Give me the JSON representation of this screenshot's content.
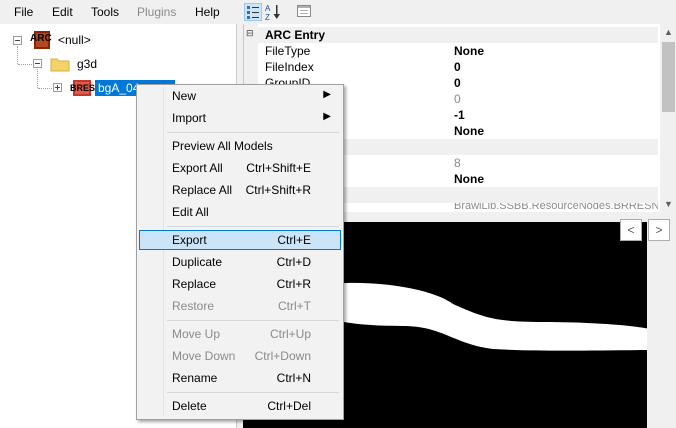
{
  "menubar": {
    "items": [
      {
        "label": "File"
      },
      {
        "label": "Edit"
      },
      {
        "label": "Tools"
      },
      {
        "label": "Plugins"
      },
      {
        "label": "Help"
      }
    ]
  },
  "toolbar": {
    "buttons": [
      {
        "icon": "categorized-view-icon",
        "checked": true
      },
      {
        "icon": "sort-az-icon",
        "checked": false
      },
      {
        "icon": "property-pages-icon",
        "checked": false
      }
    ]
  },
  "tree": {
    "root": {
      "badge": "ARC",
      "label": "<null>"
    },
    "folder": {
      "label": "g3d"
    },
    "item": {
      "badge": "BRES",
      "label": "bgA_04"
    }
  },
  "properties": {
    "category": "ARC Entry",
    "rows": [
      {
        "name": "FileType",
        "value": "None",
        "grey": false
      },
      {
        "name": "FileIndex",
        "value": "0",
        "grey": false
      },
      {
        "name": "GroupID",
        "value": "0",
        "grey": false
      },
      {
        "name": "",
        "value": "0",
        "grey": true
      },
      {
        "name": "",
        "value": "-1",
        "grey": false
      },
      {
        "name": "",
        "value": "None",
        "grey": false
      },
      {
        "name": "",
        "value": "",
        "grey": false
      },
      {
        "name": "",
        "value": "8",
        "grey": true
      },
      {
        "name": "",
        "value": "None",
        "grey": false
      },
      {
        "name": "",
        "value": "",
        "grey": false
      },
      {
        "name": "",
        "value": "BrawlLib.SSBB.ResourceNodes.BRRESN...",
        "grey": true
      }
    ]
  },
  "preview": {
    "prev_label": "<",
    "next_label": ">"
  },
  "context_menu": {
    "items": [
      {
        "label": "New",
        "shortcut": "",
        "submenu": true,
        "disabled": false,
        "highlighted": false
      },
      {
        "label": "Import",
        "shortcut": "",
        "submenu": true,
        "disabled": false,
        "highlighted": false
      },
      {
        "label": "Preview All Models",
        "shortcut": "",
        "submenu": false,
        "disabled": false,
        "highlighted": false
      },
      {
        "label": "Export All",
        "shortcut": "Ctrl+Shift+E",
        "submenu": false,
        "disabled": false,
        "highlighted": false
      },
      {
        "label": "Replace All",
        "shortcut": "Ctrl+Shift+R",
        "submenu": false,
        "disabled": false,
        "highlighted": false
      },
      {
        "label": "Edit All",
        "shortcut": "",
        "submenu": false,
        "disabled": false,
        "highlighted": false
      },
      {
        "label": "Export",
        "shortcut": "Ctrl+E",
        "submenu": false,
        "disabled": false,
        "highlighted": true
      },
      {
        "label": "Duplicate",
        "shortcut": "Ctrl+D",
        "submenu": false,
        "disabled": false,
        "highlighted": false
      },
      {
        "label": "Replace",
        "shortcut": "Ctrl+R",
        "submenu": false,
        "disabled": false,
        "highlighted": false
      },
      {
        "label": "Restore",
        "shortcut": "Ctrl+T",
        "submenu": false,
        "disabled": true,
        "highlighted": false
      },
      {
        "label": "Move Up",
        "shortcut": "Ctrl+Up",
        "submenu": false,
        "disabled": true,
        "highlighted": false
      },
      {
        "label": "Move Down",
        "shortcut": "Ctrl+Down",
        "submenu": false,
        "disabled": true,
        "highlighted": false
      },
      {
        "label": "Rename",
        "shortcut": "Ctrl+N",
        "submenu": false,
        "disabled": false,
        "highlighted": false
      },
      {
        "label": "Delete",
        "shortcut": "Ctrl+Del",
        "submenu": false,
        "disabled": false,
        "highlighted": false
      }
    ]
  },
  "colors": {
    "selection": "#0078d7",
    "menu_highlight": "#cce4f7",
    "arc_badge": "#8b2500",
    "bres_badge": "#c0392b",
    "folder": "#f3d36b"
  }
}
